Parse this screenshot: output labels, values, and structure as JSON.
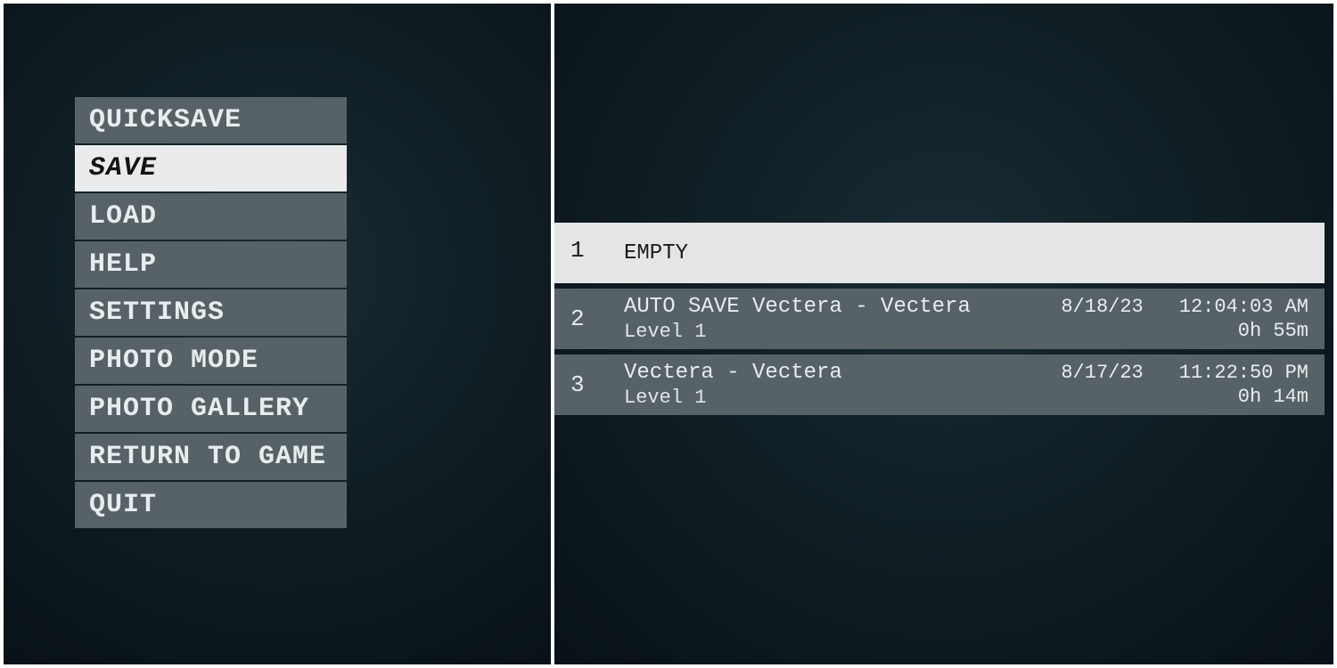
{
  "menu": {
    "items": [
      {
        "label": "QUICKSAVE",
        "selected": false
      },
      {
        "label": "SAVE",
        "selected": true
      },
      {
        "label": "LOAD",
        "selected": false
      },
      {
        "label": "HELP",
        "selected": false
      },
      {
        "label": "SETTINGS",
        "selected": false
      },
      {
        "label": "PHOTO MODE",
        "selected": false
      },
      {
        "label": "PHOTO GALLERY",
        "selected": false
      },
      {
        "label": "RETURN TO GAME",
        "selected": false
      },
      {
        "label": "QUIT",
        "selected": false
      }
    ]
  },
  "slots": [
    {
      "index": "1",
      "title": "EMPTY",
      "subtitle": "",
      "date": "",
      "time": "",
      "duration": "",
      "selected": true,
      "empty": true
    },
    {
      "index": "2",
      "title": "AUTO SAVE Vectera - Vectera",
      "subtitle": "Level 1",
      "date": "8/18/23",
      "time": "12:04:03 AM",
      "duration": "0h 55m",
      "selected": false,
      "empty": false
    },
    {
      "index": "3",
      "title": "Vectera - Vectera",
      "subtitle": "Level 1",
      "date": "8/17/23",
      "time": "11:22:50 PM",
      "duration": "0h 14m",
      "selected": false,
      "empty": false
    }
  ]
}
